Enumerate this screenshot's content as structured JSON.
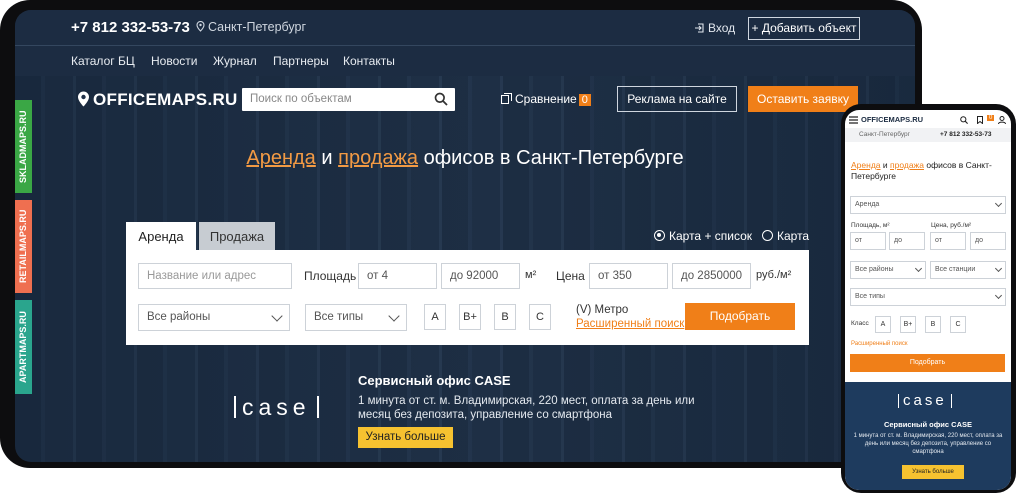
{
  "top": {
    "phone": "+7 812 332-53-73",
    "city": "Санкт-Петербург",
    "login": "Вход",
    "add_object": "+ Добавить объект"
  },
  "nav": [
    "Каталог БЦ",
    "Новости",
    "Журнал",
    "Партнеры",
    "Контакты"
  ],
  "logo": "OFFICEMAPS.RU",
  "search": {
    "placeholder": "Поиск по объектам"
  },
  "compare": {
    "label": "Сравнение",
    "count": "0"
  },
  "ad_button": "Реклама на сайте",
  "request_button": "Оставить заявку",
  "headline": {
    "rent": "Аренда",
    "and": " и ",
    "sale": "продажа",
    "rest": " офисов в Санкт-Петербурге"
  },
  "tabs": [
    "Аренда",
    "Продажа"
  ],
  "view": {
    "map_list": "Карта + список",
    "map": "Карта"
  },
  "form": {
    "name_placeholder": "Название или адрес",
    "area_label": "Площадь",
    "area_from": "от 4",
    "area_to": "до 92000",
    "area_unit": "м²",
    "price_label": "Цена",
    "price_from": "от 350",
    "price_to": "до 2850000",
    "price_unit": "руб./м²",
    "district": "Все районы",
    "type": "Все типы",
    "classes": [
      "A",
      "B+",
      "B",
      "C"
    ],
    "metro_icon": "(V)",
    "metro": "Метро",
    "advanced": "Расширенный поиск",
    "submit": "Подобрать"
  },
  "promo": {
    "logo": "case",
    "title": "Сервисный офис CASE",
    "desc": "1 минута от ст. м. Владимирская, 220 мест, оплата за день или месяц без депозита, управление со смартфона",
    "button": "Узнать больше"
  },
  "side_tabs": [
    {
      "label": "SKLADMAPS.RU",
      "color": "#3aa745"
    },
    {
      "label": "RETAILMAPS.RU",
      "color": "#ef6f50"
    },
    {
      "label": "APARTMAPS.RU",
      "color": "#2aa58d"
    }
  ],
  "mobile": {
    "logo": "OFFICEMAPS.RU",
    "city": "Санкт-Петербург",
    "phone": "+7 812 332-53-73",
    "headline_rent": "Аренда",
    "headline_and": " и ",
    "headline_sale": "продажа",
    "headline_rest": " офисов в Санкт-Петербурге",
    "deal": "Аренда",
    "area_label": "Площадь, м²",
    "price_label": "Цена, руб./м²",
    "from": "от",
    "to": "до",
    "district": "Все районы",
    "station": "Все станции",
    "type": "Все типы",
    "class_label": "Класс",
    "classes": [
      "A",
      "B+",
      "B",
      "C"
    ],
    "advanced": "Расширенный поиск",
    "submit": "Подобрать",
    "promo_logo": "case",
    "promo_title": "Сервисный офис CASE",
    "promo_desc": "1 минута от ст. м. Владимирская, 220 мест, оплата за день или месяц без депозита, управление со смартфона",
    "promo_button": "Узнать больше",
    "compare_count": "0"
  },
  "colors": {
    "accent": "#f07f18",
    "yellow": "#f6c230",
    "topbar": "#1c2c42",
    "mobile_promo": "#1e3b5e"
  }
}
